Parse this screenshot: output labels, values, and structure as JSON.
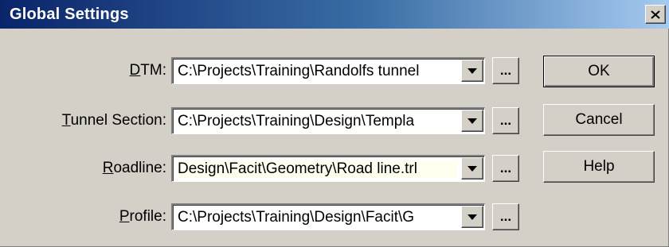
{
  "window": {
    "title": "Global Settings"
  },
  "fields": [
    {
      "label_accel": "D",
      "label_rest": "TM:",
      "value": "C:\\Projects\\Training\\Randolfs tunnel"
    },
    {
      "label_accel": "T",
      "label_rest": "unnel Section:",
      "value": "C:\\Projects\\Training\\Design\\Templa"
    },
    {
      "label_accel": "R",
      "label_rest": "oadline:",
      "value": "Design\\Facit\\Geometry\\Road line.trl"
    },
    {
      "label_accel": "P",
      "label_rest": "rofile:",
      "value": "C:\\Projects\\Training\\Design\\Facit\\G"
    }
  ],
  "browse_label": "...",
  "buttons": {
    "ok": "OK",
    "cancel": "Cancel",
    "help": "Help"
  },
  "icons": {
    "close": "close-icon",
    "dropdown": "triangle-down-icon"
  }
}
